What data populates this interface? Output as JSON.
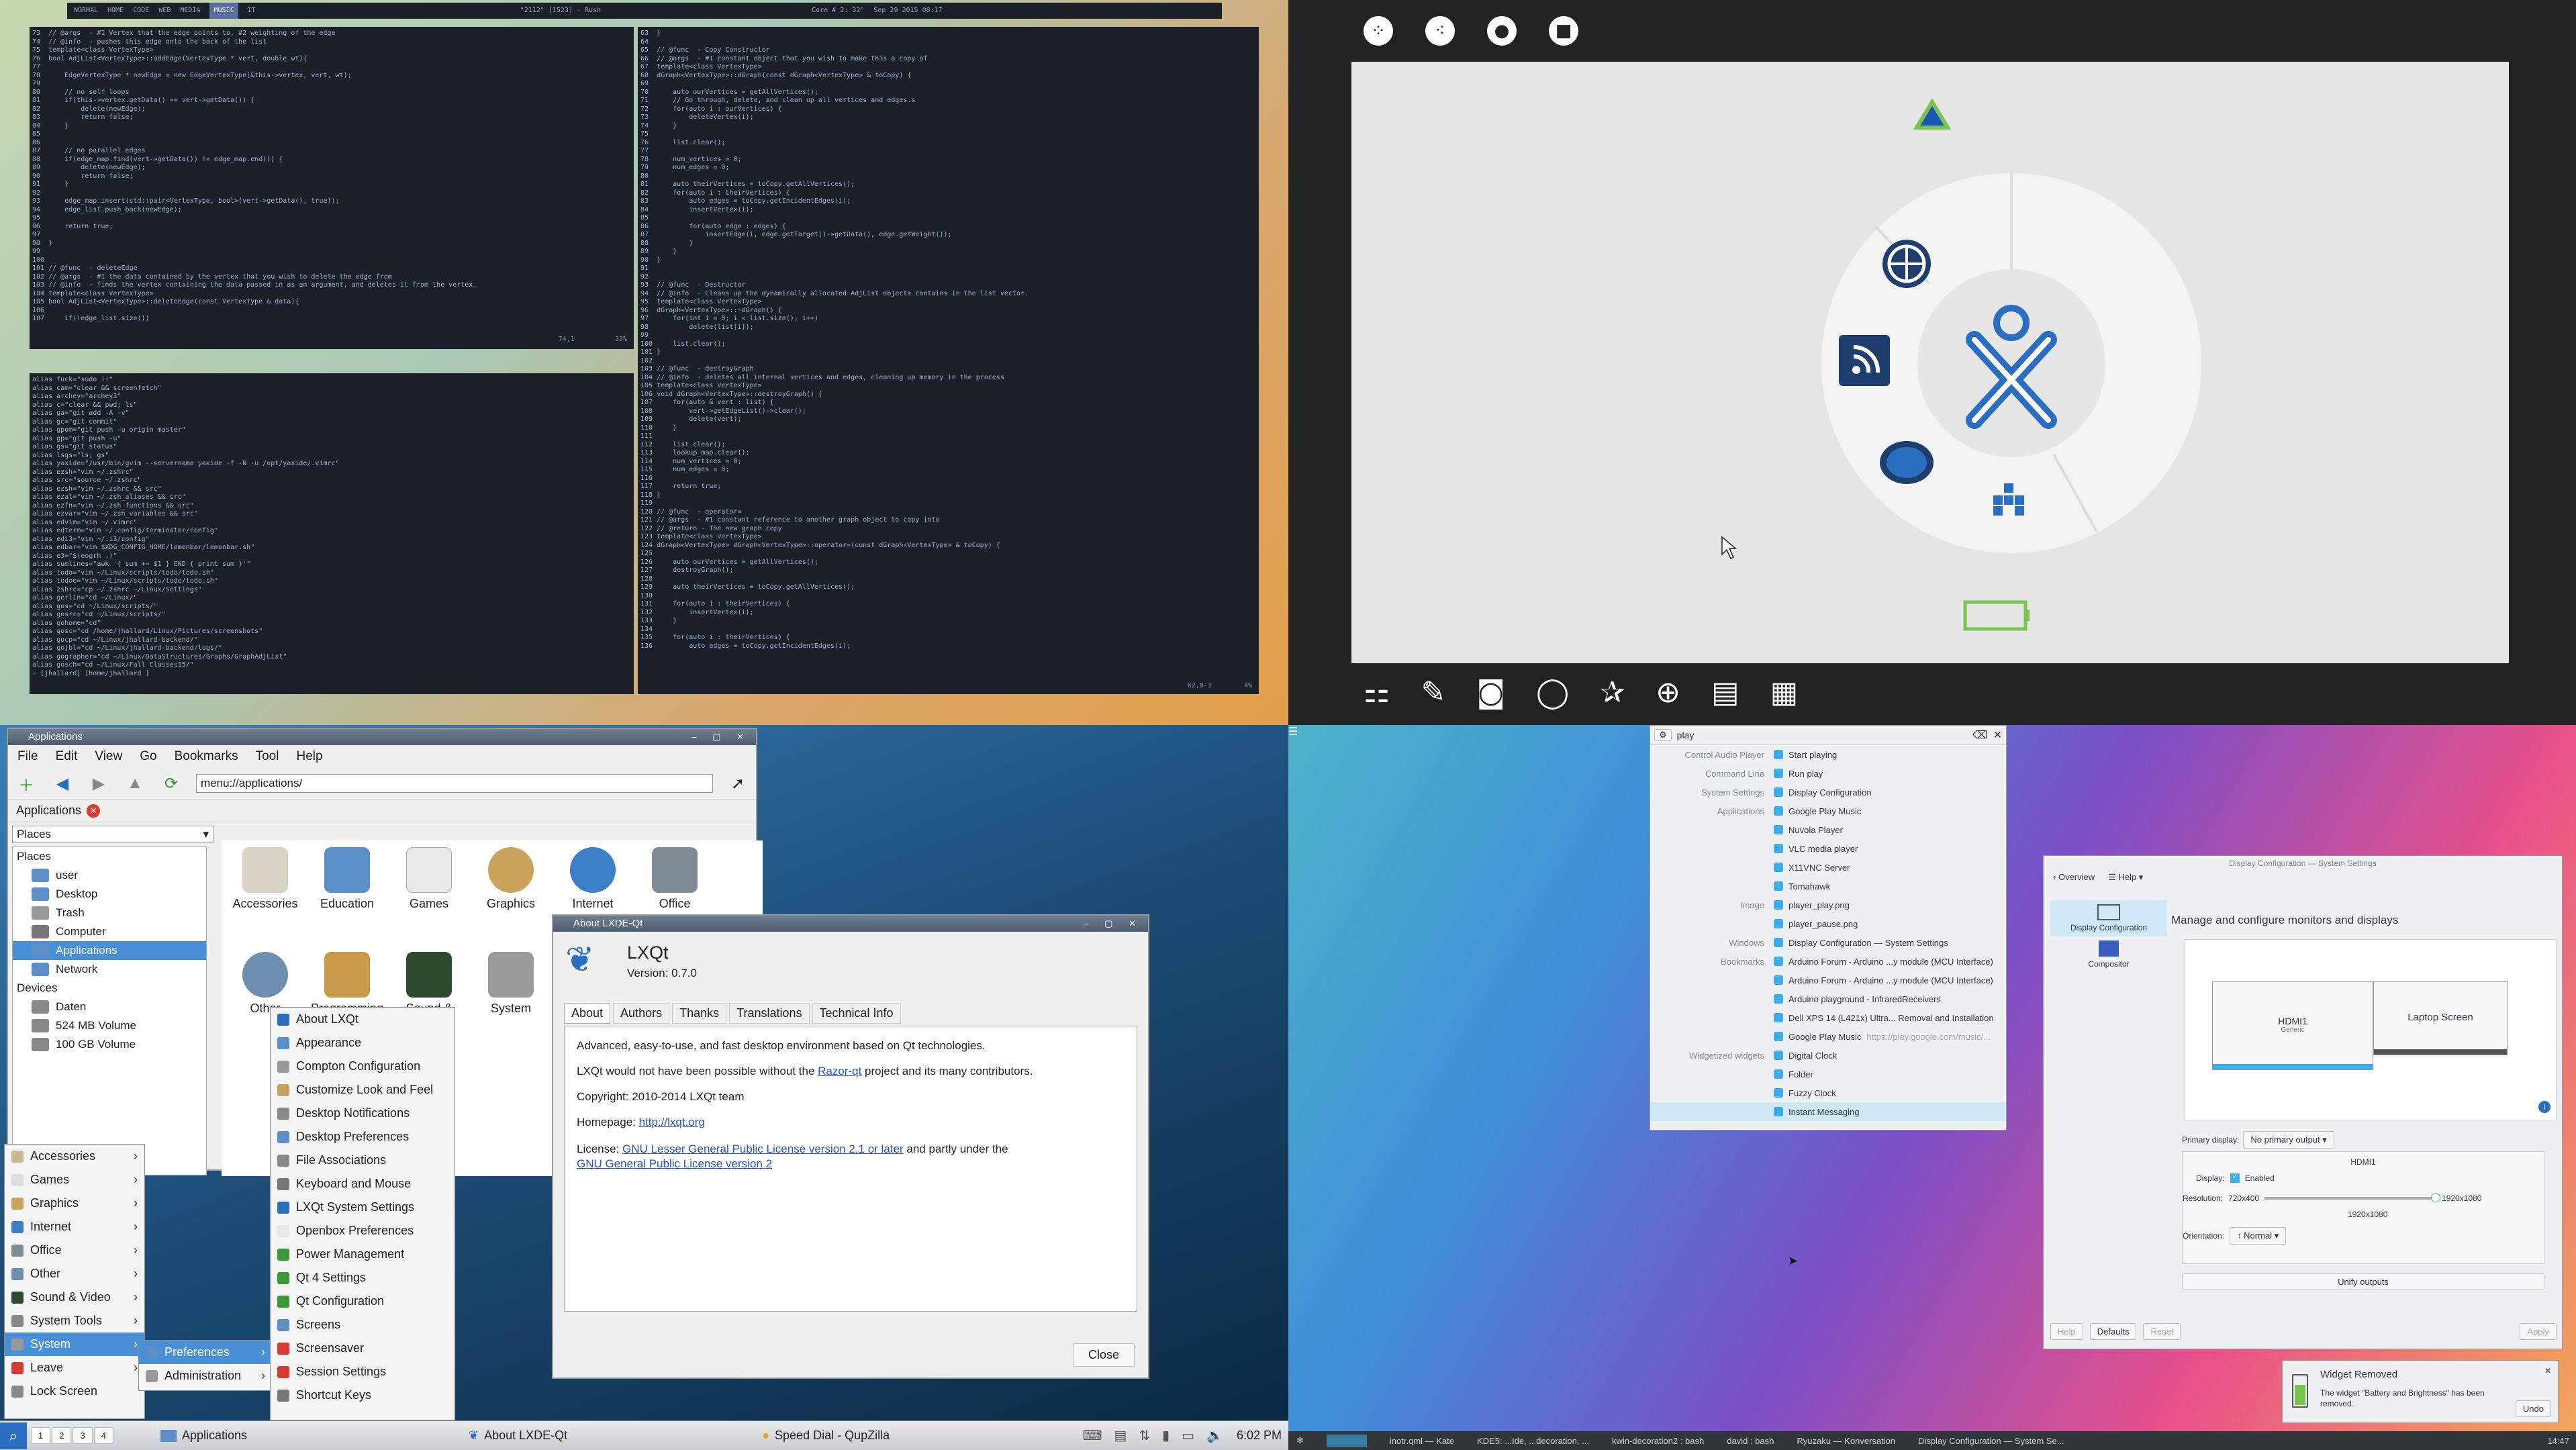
{
  "q1": {
    "tmux": {
      "left": "NORMAL",
      "tabs": [
        "HOME",
        "CODE",
        "WEB",
        "MEDIA",
        "MUSIC",
        "IT"
      ],
      "active": "MUSIC",
      "center": "\"2112\" [1523] - Rush",
      "right": "Core # 2: 32°",
      "right2": "Sep 29 2015 08:17"
    },
    "editor_left": [
      "73  // @args  - #1 Vertex that the edge points to, #2 weighting of the edge",
      "74  // @info  - pushes this edge onto the back of the list",
      "75  template<class VertexType>",
      "76  bool AdjList<VertexType>::addEdge(VertexType * vert, double wt){",
      "77",
      "78      EdgeVertexType * newEdge = new EdgeVertexType(&this->vertex, vert, wt);",
      "79",
      "80      // no self loops",
      "81      if(this->vertex.getData() == vert->getData()) {",
      "82          delete(newEdge);",
      "83          return false;",
      "84      }",
      "85",
      "86",
      "87      // no parallel edges",
      "88      if(edge_map.find(vert->getData()) != edge_map.end()) {",
      "89          delete(newEdge);",
      "90          return false;",
      "91      }",
      "92",
      "93      edge_map.insert(std::pair<VertexType, bool>(vert->getData(), true));",
      "94      edge_list.push_back(newEdge);",
      "95",
      "96      return true;",
      "97",
      "98  }",
      "99",
      "100",
      "101 // @func  - deleteEdge",
      "102 // @args  - #1 the data contained by the vertex that you wish to delete the edge from",
      "103 // @info  - finds the vertex containing the data passed in as an argument, and deletes it from the vertex.",
      "104 template<class VertexType>",
      "105 bool AdjList<VertexType>::deleteEdge(const VertexType & data){",
      "106",
      "107     if(!edge_list.size())"
    ],
    "editor_left_status": "74,1          33%",
    "editor_right": [
      "63  }",
      "64",
      "65  // @func  - Copy Constructor",
      "66  // @args  - #1 constant object that you wish to make this a copy of",
      "67  template<class VertexType>",
      "68  dGraph<VertexType>::dGraph(const dGraph<VertexType> & toCopy) {",
      "69",
      "70      auto ourVertices = getAllVertices();",
      "71      // Go through, delete, and clean up all vertices and edges.s",
      "72      for(auto i : ourVertices) {",
      "73          deleteVertex(i);",
      "74      }",
      "75",
      "76      list.clear();",
      "77",
      "78      num_vertices = 0;",
      "79      num_edges = 0;",
      "80",
      "81      auto theirVertices = toCopy.getAllVertices();",
      "82      for(auto i : theirVertices) {",
      "83          auto edges = toCopy.getIncidentEdges(i);",
      "84          insertVertex(i);",
      "85",
      "86          for(auto edge : edges) {",
      "87              insertEdge(i, edge.getTarget()->getData(), edge.getWeight());",
      "88          }",
      "89      }",
      "90  }",
      "91",
      "92",
      "93  // @func  - Destructor",
      "94  // @info  - Cleans up the dynamically allocated AdjList objects contains in the list vector.",
      "95  template<class VertexType>",
      "96  dGraph<VertexType>::~dGraph() {",
      "97      for(int i = 0; i < list.size(); i++)",
      "98          delete(list[i]);",
      "99",
      "100     list.clear();",
      "101 }",
      "102",
      "103 // @func  - destroyGraph",
      "104 // @info  - deletes all internal vertices and edges, cleaning up memory in the process",
      "105 template<class VertexType>",
      "106 void dGraph<VertexType>::destroyGraph() {",
      "107     for(auto & vert : list) {",
      "108         vert->getEdgeList()->clear();",
      "109         delete(vert);",
      "110     }",
      "111",
      "112     list.clear();",
      "113     lookup_map.clear();",
      "114     num_vertices = 0;",
      "115     num_edges = 0;",
      "116",
      "117     return true;",
      "118 }",
      "119",
      "120 // @func  - operator=",
      "121 // @args  - #1 constant reference to another graph object to copy into",
      "122 // @return - The new graph copy",
      "123 template<class VertexType>",
      "124 dGraph<VertexType> dGraph<VertexType>::operator=(const dGraph<VertexType> & toCopy) {",
      "125",
      "126     auto ourVertices = getAllVertices();",
      "127     destroyGraph();",
      "128",
      "129     auto theirVertices = toCopy.getAllVertices();",
      "130",
      "131     for(auto i : theirVertices) {",
      "132         insertVertex(i);",
      "133     }",
      "134",
      "135     for(auto i : theirVertices) {",
      "136         auto edges = toCopy.getIncidentEdges(i);"
    ],
    "editor_right_status": "62,0-1        4%",
    "shell": [
      "alias fuck=\"sudo !!\"",
      "alias cam=\"clear && screenfetch\"",
      "alias archey=\"archey3\"",
      "alias c=\"clear && pwd; ls\"",
      "alias ga=\"git add -A -v\"",
      "alias gc=\"git commit\"",
      "alias gpom=\"git push -u origin master\"",
      "alias gp=\"git push -u\"",
      "alias gs=\"git status\"",
      "alias lsgs=\"ls; gs\"",
      "alias yaxide=\"/usr/bin/gvim --servername yaxide -f -N -u /opt/yaxide/.vimrc\"",
      "alias ezsh=\"vim ~/.zshrc\"",
      "alias src=\"source ~/.zshrc\"",
      "alias ezsh=\"vim ~/.zshrc && src\"",
      "alias ezal=\"vim ~/.zsh_aliases && src\"",
      "alias ezfn=\"vim ~/.zsh_functions && src\"",
      "alias ezvar=\"vim ~/.zsh_variables && src\"",
      "alias edvim=\"vim ~/.vimrc\"",
      "alias edterm=\"vim ~/.config/terminator/config\"",
      "alias edi3=\"vim ~/.i3/config\"",
      "alias edbar=\"vim $XDG_CONFIG_HOME/lemonbar/lemonbar.sh\"",
      "alias e3=\"$(eogrh .)\"",
      "alias sumlines=\"awk '{ sum += $1 } END { print sum }'\"",
      "alias todo=\"vim ~/Linux/scripts/todo/todo.sh\"",
      "alias todoe=\"vim ~/Linux/scripts/todo/todo.sh\"",
      "alias zshrc=\"cp ~/.zshrc ~/Linux/Settings\"",
      "alias gerlin=\"cd ~/Linux/\"",
      "alias gos=\"cd ~/Linux/scripts/\"",
      "alias gosrc=\"cd ~/Linux/scripts/\"",
      "alias gohome=\"cd\"",
      "alias gosc=\"cd /home/jhallard/Linux/Pictures/screenshots\"",
      "alias gocp=\"cd ~/Linux/jhallard-backend/\"",
      "alias gojbl=\"cd ~/Linux/jhallard-backend/logs/\"",
      "alias gographer=\"cd ~/Linux/DataStructures/Graphs/GraphAdjList\"",
      "alias gosch=\"cd ~/Linux/Fall Classes15/\"",
      "~ [jhallard] [home/jhallard ]"
    ]
  },
  "q2": {
    "top_icons": [
      "neighborhood-view",
      "group-view",
      "home-view",
      "activity-view"
    ],
    "bottom_icons": [
      "journal",
      "write",
      "browse-rss",
      "chat",
      "chart",
      "browse",
      "read",
      "more-apps"
    ],
    "battery_color": "#78c44c",
    "xo_color": "#2a6ec2",
    "triangle_color": "#1a56b8"
  },
  "q3": {
    "fm": {
      "title": "Applications",
      "menus": [
        "File",
        "Edit",
        "View",
        "Go",
        "Bookmarks",
        "Tool",
        "Help"
      ],
      "address": "menu://applications/",
      "tab": "Applications",
      "places_combo": "Places",
      "places_header": "Places",
      "places": [
        "user",
        "Desktop",
        "Trash",
        "Computer",
        "Applications",
        "Network"
      ],
      "devices_header": "Devices",
      "devices": [
        "Daten",
        "524 MB Volume",
        "100 GB Volume"
      ],
      "icons": [
        "Accessories",
        "Education",
        "Games",
        "Graphics",
        "Internet",
        "Office",
        "Other",
        "Programming",
        "Sound &",
        "System"
      ]
    },
    "about": {
      "title": "About LXDE-Qt",
      "name": "LXQt",
      "version": "Version: 0.7.0",
      "tabs": [
        "About",
        "Authors",
        "Thanks",
        "Translations",
        "Technical Info"
      ],
      "p1": "Advanced, easy-to-use, and fast desktop environment based on Qt technologies.",
      "p2a": "LXQt would not have been possible without the ",
      "p2link": "Razor-qt",
      "p2b": " project and its many contributors.",
      "p3": "Copyright: 2010-2014 LXQt team",
      "p4": "Homepage: ",
      "p4link": "http://lxqt.org",
      "p5a": "License: ",
      "p5link": "GNU Lesser General Public License version 2.1 or later",
      "p5b": " and partly under the",
      "p5link2": "GNU General Public License version 2",
      "close": "Close"
    },
    "mainmenu": [
      "Accessories",
      "Games",
      "Graphics",
      "Internet",
      "Office",
      "Other",
      "Sound & Video",
      "System Tools",
      "System",
      "Leave",
      "Lock Screen"
    ],
    "submenu": [
      "Preferences",
      "Administration"
    ],
    "prefs": [
      "About LXQt",
      "Appearance",
      "Compton Configuration",
      "Customize Look and Feel",
      "Desktop Notifications",
      "Desktop Preferences",
      "File Associations",
      "Keyboard and Mouse",
      "LXQt System Settings",
      "Openbox Preferences",
      "Power Management",
      "Qt 4 Settings",
      "Qt Configuration",
      "Screens",
      "Screensaver",
      "Session Settings",
      "Shortcut Keys"
    ],
    "taskbar": {
      "desktops": [
        "1",
        "2",
        "3",
        "4"
      ],
      "apps_label": "Applications",
      "task1": "About LXDE-Qt",
      "task2": "Speed Dial - QupZilla",
      "clock": "6:02 PM"
    }
  },
  "q4": {
    "krunner": {
      "query": "play",
      "rows": [
        {
          "cat": "Control Audio Player",
          "val": "Start playing"
        },
        {
          "cat": "Command Line",
          "val": "Run play"
        },
        {
          "cat": "System Settings",
          "val": "Display Configuration"
        },
        {
          "cat": "Applications",
          "val": "Google Play Music"
        },
        {
          "cat": "",
          "val": "Nuvola Player"
        },
        {
          "cat": "",
          "val": "VLC media player"
        },
        {
          "cat": "",
          "val": "X11VNC Server"
        },
        {
          "cat": "",
          "val": "Tomahawk"
        },
        {
          "cat": "Image",
          "val": "player_play.png"
        },
        {
          "cat": "",
          "val": "player_pause.png"
        },
        {
          "cat": "Windows",
          "val": "Display Configuration — System Settings"
        },
        {
          "cat": "Bookmarks",
          "val": "Arduino Forum - Arduino ...y module (MCU Interface)"
        },
        {
          "cat": "",
          "val": "Arduino Forum - Arduino ...y module (MCU Interface)"
        },
        {
          "cat": "",
          "val": "Arduino playground - InfraredReceivers"
        },
        {
          "cat": "",
          "val": "Dell XPS 14 (L421x) Ultra... Removal and Installation"
        },
        {
          "cat": "",
          "val": "Google Play Music"
        },
        {
          "cat": "Widgetized widgets",
          "val": "Digital Clock"
        },
        {
          "cat": "",
          "val": "Folder"
        },
        {
          "cat": "",
          "val": "Fuzzy Clock"
        },
        {
          "cat": "",
          "val": "Instant Messaging"
        }
      ],
      "gpm_url": "https://play.google.com/music/..."
    },
    "settings": {
      "title": "Display Configuration — System Settings",
      "overview": "Overview",
      "help": "Help",
      "side": [
        "Display Configuration",
        "Compositor"
      ],
      "heading": "Manage and configure monitors and displays",
      "mon1": "HDMI1",
      "mon1sub": "Generic",
      "mon2": "Laptop Screen",
      "primary_label": "Primary display:",
      "primary_val": "No primary output",
      "out_name": "HDMI1",
      "display_label": "Display:",
      "enabled": "Enabled",
      "res_label": "Resolution:",
      "res_min": "720x400",
      "res_max": "1920x1080",
      "res_val": "1920x1080",
      "orient_label": "Orientation:",
      "orient_val": "Normal",
      "unify": "Unify outputs",
      "btn_help": "Help",
      "btn_defaults": "Defaults",
      "btn_reset": "Reset",
      "btn_apply": "Apply"
    },
    "notify": {
      "title": "Widget Removed",
      "body": "The widget \"Battery and Brightness\" has been removed.",
      "undo": "Undo"
    },
    "taskbar": {
      "items": [
        "inotr.qml — Kate",
        "KDE5: ...Ide, ...decoration, ...",
        "kwin-decoration2 : bash",
        "david : bash",
        "Ryuzaku — Konversation",
        "Display Configuration — System Se..."
      ],
      "clock": "14:47"
    }
  }
}
